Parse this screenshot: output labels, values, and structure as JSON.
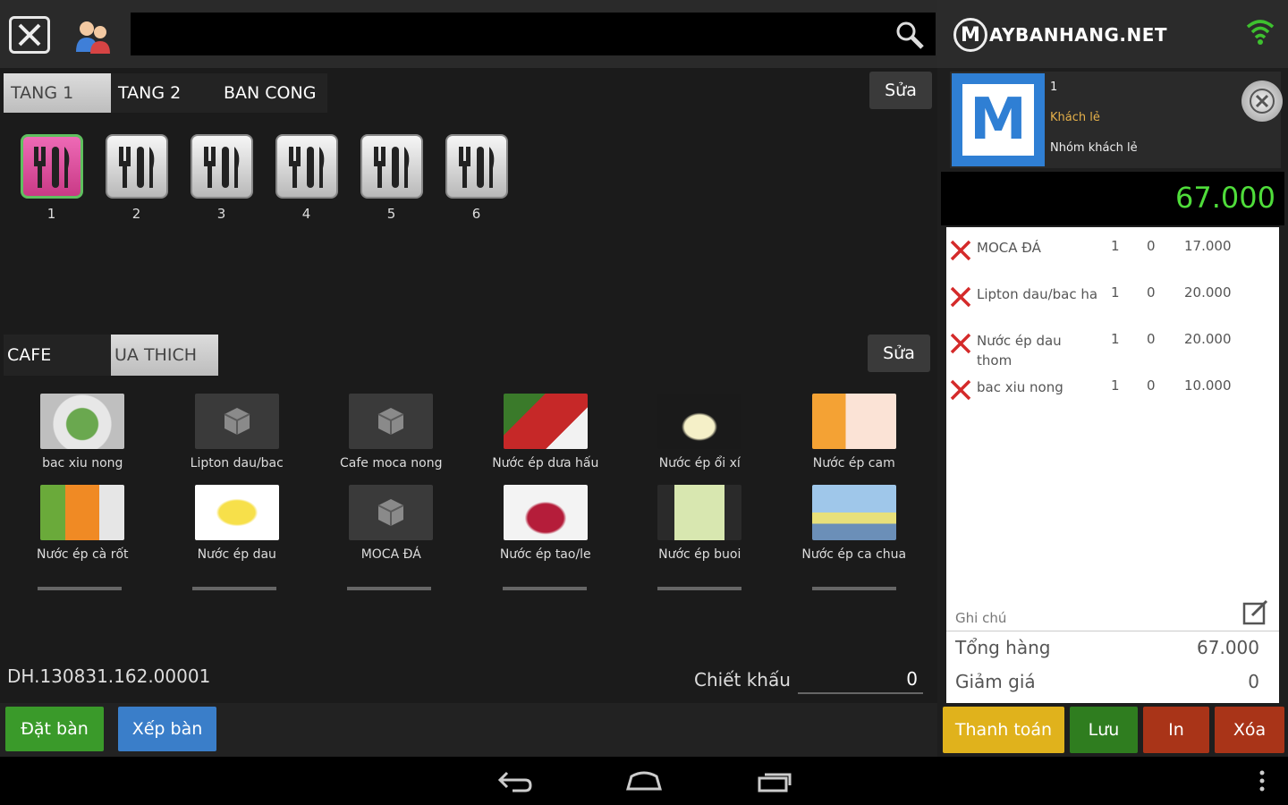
{
  "search": {
    "placeholder": ""
  },
  "brand": {
    "mark": "M",
    "text": "AYBANHANG.NET"
  },
  "floors": {
    "tabs": [
      "TANG 1",
      "TANG 2",
      "BAN CONG"
    ],
    "edit_label": "Sửa"
  },
  "tables": [
    "1",
    "2",
    "3",
    "4",
    "5",
    "6"
  ],
  "categories": {
    "tabs": [
      "CAFE",
      "UA THICH"
    ],
    "edit_label": "Sửa"
  },
  "products": [
    "bac xiu nong",
    "Lipton dau/bac",
    "Cafe moca nong",
    "Nước ép dưa hấu",
    "Nước ép ổi xí",
    "Nước ép cam",
    "Nước ép cà rốt",
    "Nước ép dau",
    "MOCA ĐÁ",
    "Nước ép tao/le",
    "Nước ép buoi",
    "Nước ép ca chua"
  ],
  "order_code": "DH.130831.162.00001",
  "discount": {
    "label": "Chiết khấu",
    "value": "0"
  },
  "actions": {
    "reserve": "Đặt bàn",
    "arrange": "Xếp bàn"
  },
  "customer": {
    "table_no": "1",
    "name": "Khách lẻ",
    "group": "Nhóm khách lẻ",
    "logo_letter": "M"
  },
  "total": "67.000",
  "order_lines": [
    {
      "name": "MOCA ĐÁ",
      "qty": "1",
      "disc": "0",
      "price": "17.000"
    },
    {
      "name": "Lipton dau/bac ha",
      "qty": "1",
      "disc": "0",
      "price": "20.000"
    },
    {
      "name": "Nước ép dau thom",
      "qty": "1",
      "disc": "0",
      "price": "20.000"
    },
    {
      "name": "bac xiu nong",
      "qty": "1",
      "disc": "0",
      "price": "10.000"
    }
  ],
  "note": {
    "label": "Ghi chú"
  },
  "summary": {
    "subtotal_label": "Tổng hàng",
    "subtotal_value": "67.000",
    "discount_label": "Giảm giá",
    "discount_value": "0"
  },
  "right_actions": {
    "pay": "Thanh toán",
    "save": "Lưu",
    "print": "In",
    "delete": "Xóa"
  },
  "colors": {
    "accent_green": "#4fdd3a",
    "pay": "#e0b21c",
    "save": "#2f7d1f",
    "print": "#a93418",
    "delete": "#a93418",
    "reserve": "#3a9a2a",
    "arrange": "#3a7ec9"
  }
}
